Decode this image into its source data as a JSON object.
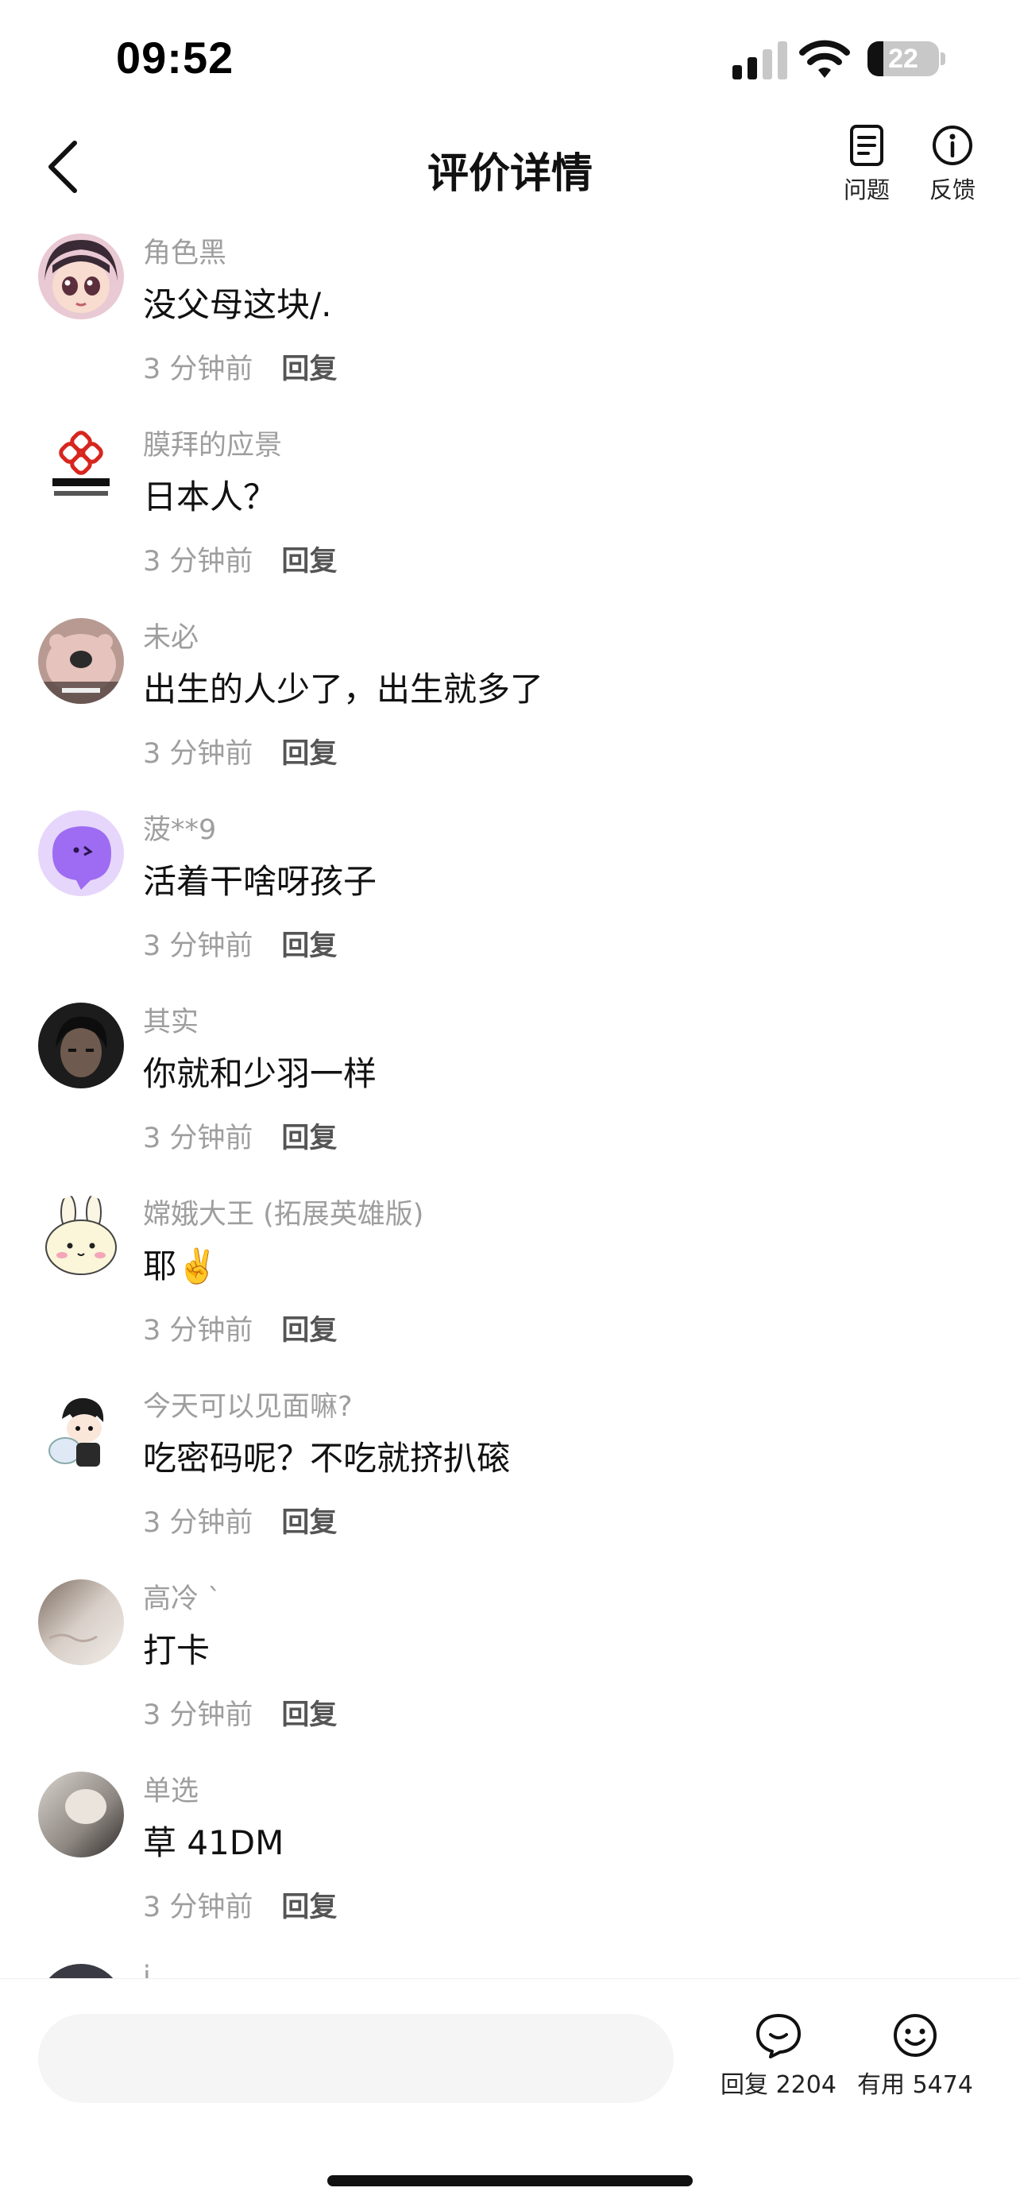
{
  "status_bar": {
    "time": "09:52",
    "battery": "22",
    "battery_level": 0.22
  },
  "nav": {
    "title": "评价详情",
    "actions": [
      {
        "label": "问题",
        "icon": "document-icon"
      },
      {
        "label": "反馈",
        "icon": "info-icon"
      }
    ]
  },
  "comments": [
    {
      "user": "角色黑",
      "text": "没父母这块/.",
      "time": "3 分钟前",
      "reply_label": "回复",
      "avatar": "anime-girl-avatar"
    },
    {
      "user": "膜拜的应景",
      "text": "日本人？",
      "time": "3 分钟前",
      "reply_label": "回复",
      "avatar": "china-unicom-logo-avatar"
    },
    {
      "user": "未必",
      "text": "出生的人少了，出生就多了",
      "time": "3 分钟前",
      "reply_label": "回复",
      "avatar": "pig-avatar"
    },
    {
      "user": "菠**9",
      "text": "活着干啥呀孩子",
      "time": "3 分钟前",
      "reply_label": "回复",
      "avatar": "purple-blob-avatar"
    },
    {
      "user": "其实",
      "text": "你就和少羽一样",
      "time": "3 分钟前",
      "reply_label": "回复",
      "avatar": "dark-portrait-avatar"
    },
    {
      "user": "嫦娥大王 (拓展英雄版)",
      "text": "耶✌️",
      "time": "3 分钟前",
      "reply_label": "回复",
      "avatar": "bunny-avatar"
    },
    {
      "user": "今天可以见面嘛?",
      "text": "吃密码呢？不吃就挤扒磙",
      "time": "3 分钟前",
      "reply_label": "回复",
      "avatar": "cartoon-boy-avatar"
    },
    {
      "user": "高冷 ˋ",
      "text": "打卡",
      "time": "3 分钟前",
      "reply_label": "回复",
      "avatar": "soft-photo-avatar"
    },
    {
      "user": "单选",
      "text": "草 41DM",
      "time": "3 分钟前",
      "reply_label": "回复",
      "avatar": "gray-photo-avatar"
    },
    {
      "user": "i",
      "text": "",
      "time": "",
      "reply_label": "",
      "avatar": "partial-avatar"
    }
  ],
  "bottom_bar": {
    "input_placeholder": "",
    "reply": {
      "label": "回复",
      "count": "2204",
      "icon": "comment-bubble-icon"
    },
    "useful": {
      "label": "有用",
      "count": "5474",
      "icon": "smiley-icon"
    }
  },
  "colors": {
    "text": "#111111",
    "meta": "#9e9e9e",
    "reply": "#555555",
    "input_bg": "#f5f5f5"
  }
}
